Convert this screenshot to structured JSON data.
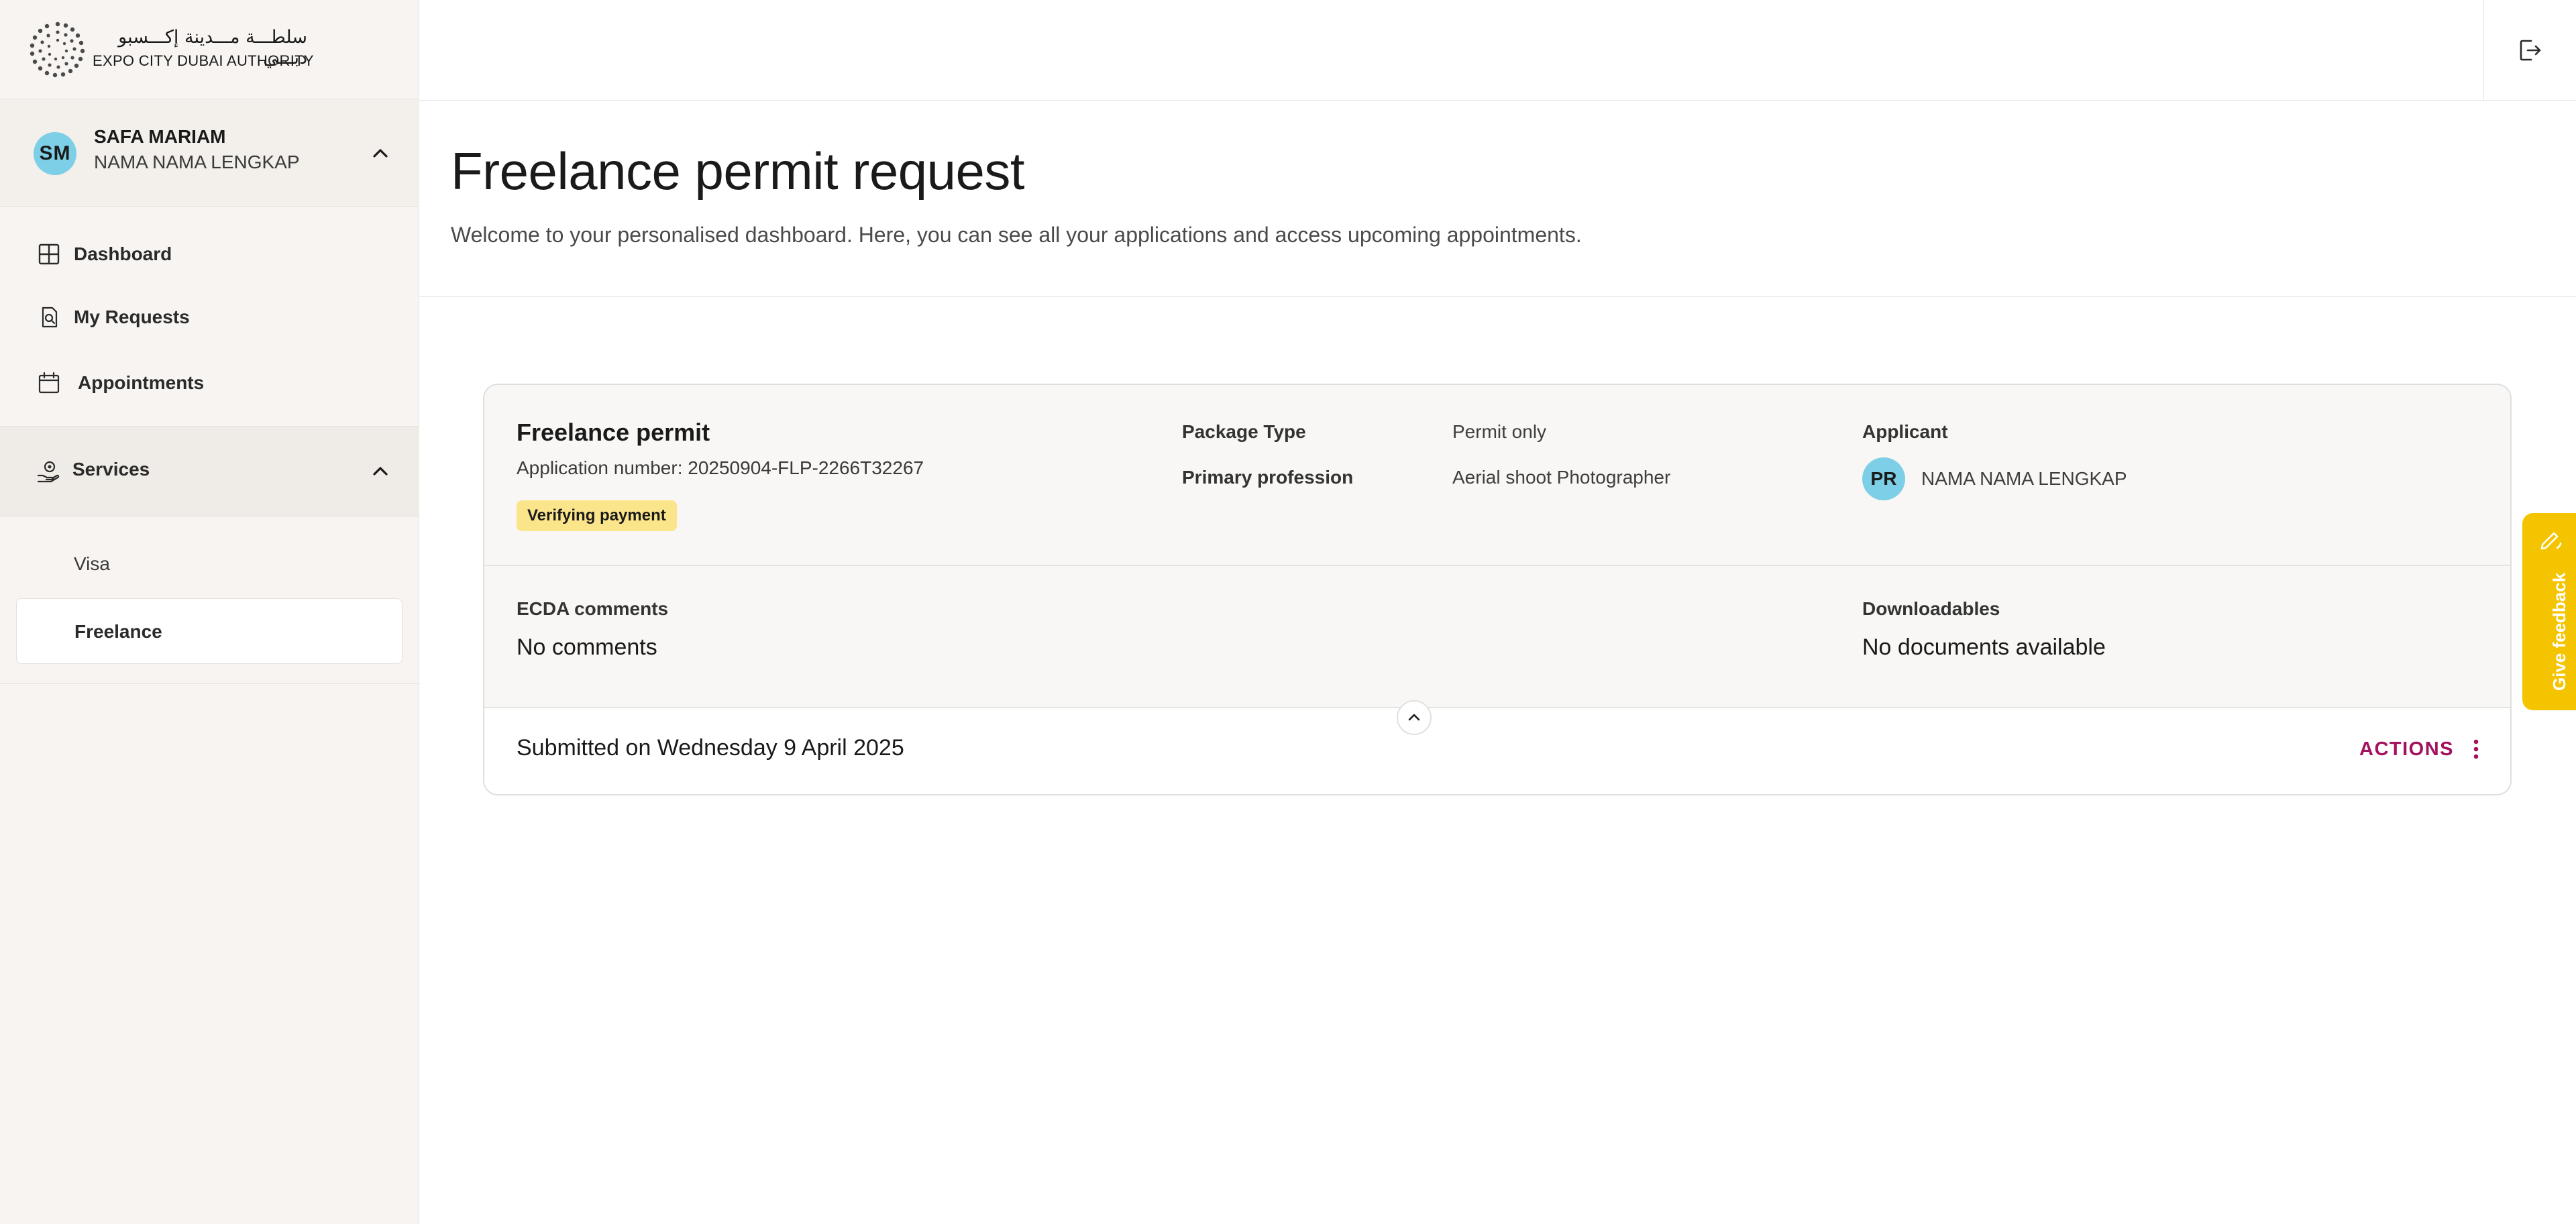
{
  "brand": {
    "name_ar": "سلطـــة مـــدينة إكـــسبو دبـــي",
    "name_en": "EXPO CITY DUBAI AUTHORITY"
  },
  "user": {
    "initials": "SM",
    "name": "SAFA MARIAM",
    "subtitle": "NAMA NAMA LENGKAP"
  },
  "sidebar": {
    "items": [
      {
        "label": "Dashboard",
        "icon": "grid-icon"
      },
      {
        "label": "My Requests",
        "icon": "document-search-icon"
      },
      {
        "label": "Appointments",
        "icon": "calendar-icon"
      }
    ],
    "services": {
      "label": "Services",
      "icon": "hand-service-icon",
      "sub_items": [
        {
          "label": "Visa"
        },
        {
          "label": "Freelance"
        }
      ]
    }
  },
  "page": {
    "title": "Freelance permit request",
    "description": "Welcome to your personalised dashboard. Here, you can see all your applications and access upcoming appointments."
  },
  "request": {
    "title": "Freelance permit",
    "application_number": "Application number: 20250904-FLP-2266T32267",
    "status": "Verifying payment",
    "package_type_label": "Package Type",
    "package_type_value": "Permit only",
    "profession_label": "Primary profession",
    "profession_value": "Aerial shoot Photographer",
    "applicant_label": "Applicant",
    "applicant_initials": "PR",
    "applicant_name": "NAMA NAMA LENGKAP",
    "comments_label": "ECDA comments",
    "comments_value": "No comments",
    "downloads_label": "Downloadables",
    "downloads_value": "No documents available",
    "submitted": "Submitted on Wednesday 9 April 2025",
    "actions_label": "ACTIONS"
  },
  "feedback": {
    "label": "Give feedback"
  },
  "colors": {
    "accent": "#a3125f",
    "status_badge": "#fbe58b",
    "feedback_tab": "#f5c400",
    "avatar": "#7ccfe6",
    "sidebar_bg": "#f7f4f1"
  }
}
